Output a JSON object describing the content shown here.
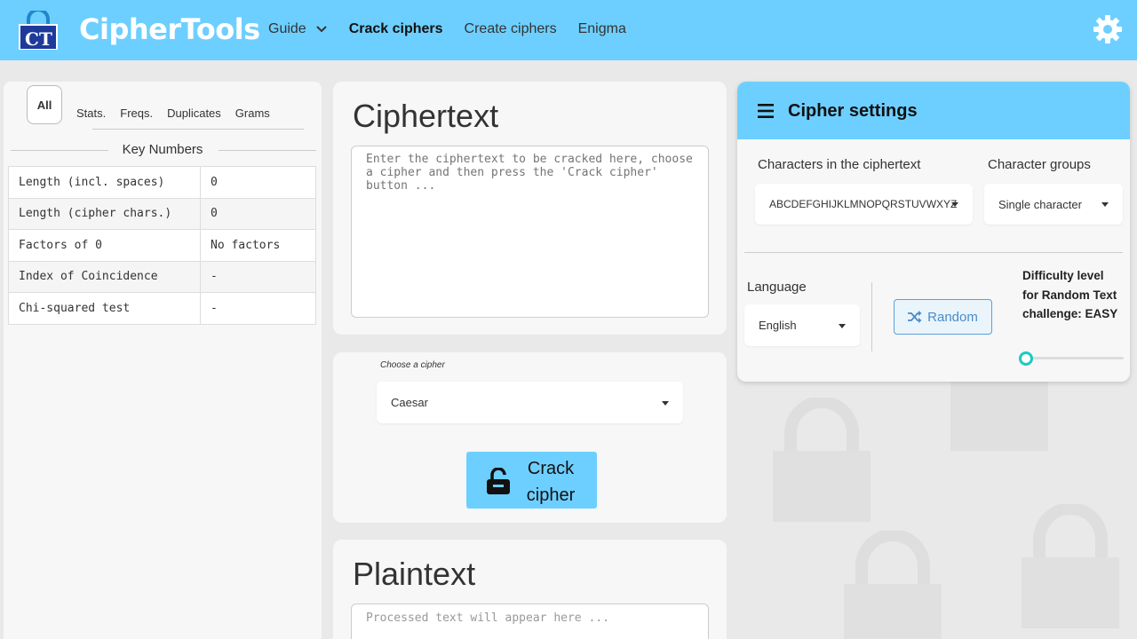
{
  "header": {
    "brand": "CipherTools",
    "logo_text": "CT",
    "nav": [
      {
        "label": "Guide",
        "has_dropdown": true,
        "active": false
      },
      {
        "label": "Crack ciphers",
        "active": true
      },
      {
        "label": "Create ciphers",
        "active": false
      },
      {
        "label": "Enigma",
        "active": false
      }
    ],
    "colors": {
      "accent": "#6dcfff"
    }
  },
  "left_panel": {
    "tabs": [
      "All",
      "Stats.",
      "Freqs.",
      "Duplicates",
      "Grams"
    ],
    "active_tab": "All",
    "section_title": "Key Numbers",
    "rows": [
      {
        "key": "Length (incl. spaces)",
        "value": "0"
      },
      {
        "key": "Length (cipher chars.)",
        "value": "0"
      },
      {
        "key": "Factors of 0",
        "value": "No factors"
      },
      {
        "key": "Index of Coincidence",
        "value": "-"
      },
      {
        "key": "Chi-squared test",
        "value": "-"
      }
    ]
  },
  "ciphertext": {
    "title": "Ciphertext",
    "placeholder": "Enter the ciphertext to be cracked here, choose a cipher and then press the 'Crack cipher' button ..."
  },
  "choose": {
    "label": "Choose a cipher",
    "selected": "Caesar",
    "crack_label": "Crack cipher"
  },
  "plaintext": {
    "title": "Plaintext",
    "placeholder": "Processed text will appear here ..."
  },
  "settings": {
    "title": "Cipher settings",
    "chars_label": "Characters in the ciphertext",
    "chars_value": "ABCDEFGHIJKLMNOPQRSTUVWXYZ",
    "groups_label": "Character groups",
    "groups_value": "Single character",
    "language_label": "Language",
    "language_value": "English",
    "random_label": "Random",
    "difficulty_text": "Difficulty level for Random Text challenge: EASY",
    "difficulty_level": 0
  }
}
